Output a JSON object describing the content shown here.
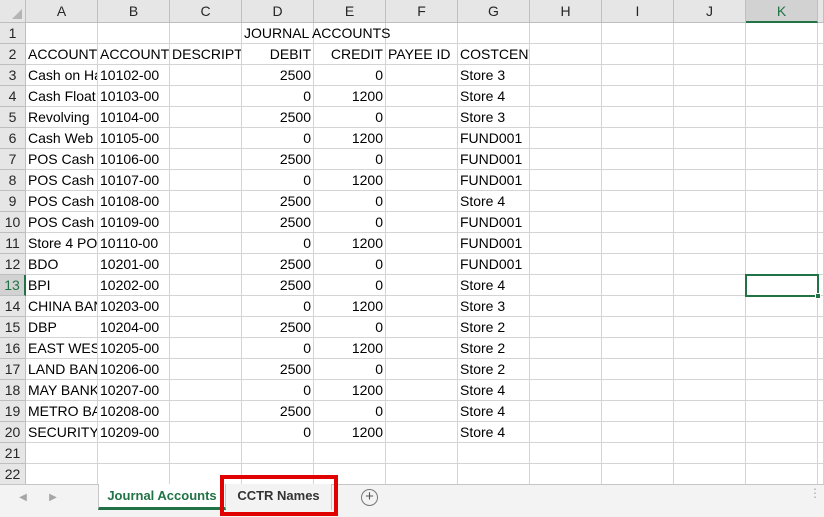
{
  "columns": [
    "A",
    "B",
    "C",
    "D",
    "E",
    "F",
    "G",
    "H",
    "I",
    "J",
    "K"
  ],
  "selected_column": "K",
  "selected_row": 13,
  "rows": [
    {
      "num": 1,
      "cells": {
        "D": "JOURNAL ACCOUNTS"
      }
    },
    {
      "num": 2,
      "cells": {
        "A": "ACCOUNT",
        "B": "ACCOUNT",
        "C": "DESCRIPTIO",
        "D": "DEBIT",
        "E": "CREDIT",
        "F": "PAYEE ID",
        "G": "COSTCENTER"
      }
    },
    {
      "num": 3,
      "cells": {
        "A": "Cash on Ha",
        "B": "10102-00",
        "D": "2500",
        "E": "0",
        "G": "Store 3"
      }
    },
    {
      "num": 4,
      "cells": {
        "A": "Cash Float",
        "B": "10103-00",
        "D": "0",
        "E": "1200",
        "G": "Store 4"
      }
    },
    {
      "num": 5,
      "cells": {
        "A": "Revolving",
        "B": "10104-00",
        "D": "2500",
        "E": "0",
        "G": "Store 3"
      }
    },
    {
      "num": 6,
      "cells": {
        "A": "Cash Web",
        "B": "10105-00",
        "D": "0",
        "E": "1200",
        "G": "FUND001"
      }
    },
    {
      "num": 7,
      "cells": {
        "A": "POS Cash -",
        "B": "10106-00",
        "D": "2500",
        "E": "0",
        "G": "FUND001"
      }
    },
    {
      "num": 8,
      "cells": {
        "A": "POS Cash (",
        "B": "10107-00",
        "D": "0",
        "E": "1200",
        "G": "FUND001"
      }
    },
    {
      "num": 9,
      "cells": {
        "A": "POS Cash S",
        "B": "10108-00",
        "D": "2500",
        "E": "0",
        "G": "Store 4"
      }
    },
    {
      "num": 10,
      "cells": {
        "A": "POS Cash c",
        "B": "10109-00",
        "D": "2500",
        "E": "0",
        "G": "FUND001"
      }
    },
    {
      "num": 11,
      "cells": {
        "A": "Store 4 PO",
        "B": "10110-00",
        "D": "0",
        "E": "1200",
        "G": "FUND001"
      }
    },
    {
      "num": 12,
      "cells": {
        "A": "BDO",
        "B": "10201-00",
        "D": "2500",
        "E": "0",
        "G": "FUND001"
      }
    },
    {
      "num": 13,
      "cells": {
        "A": "BPI",
        "B": "10202-00",
        "D": "2500",
        "E": "0",
        "G": "Store 4"
      }
    },
    {
      "num": 14,
      "cells": {
        "A": "CHINA BAN",
        "B": "10203-00",
        "D": "0",
        "E": "1200",
        "G": "Store 3"
      }
    },
    {
      "num": 15,
      "cells": {
        "A": "DBP",
        "B": "10204-00",
        "D": "2500",
        "E": "0",
        "G": "Store 2"
      }
    },
    {
      "num": 16,
      "cells": {
        "A": "EAST WEST",
        "B": "10205-00",
        "D": "0",
        "E": "1200",
        "G": "Store 2"
      }
    },
    {
      "num": 17,
      "cells": {
        "A": "LAND BAN",
        "B": "10206-00",
        "D": "2500",
        "E": "0",
        "G": "Store 2"
      }
    },
    {
      "num": 18,
      "cells": {
        "A": "MAY BANK",
        "B": "10207-00",
        "D": "0",
        "E": "1200",
        "G": "Store 4"
      }
    },
    {
      "num": 19,
      "cells": {
        "A": "METRO BA",
        "B": "10208-00",
        "D": "2500",
        "E": "0",
        "G": "Store 4"
      }
    },
    {
      "num": 20,
      "cells": {
        "A": "SECURITY",
        "B": "10209-00",
        "D": "0",
        "E": "1200",
        "G": "Store 4"
      }
    },
    {
      "num": 21,
      "cells": {}
    },
    {
      "num": 22,
      "cells": {}
    }
  ],
  "tabs": [
    {
      "label": "Journal Accounts",
      "active": true
    },
    {
      "label": "CCTR Names",
      "active": false
    }
  ],
  "add_sheet_symbol": "+",
  "icons": {
    "prev": "chevron-left-icon",
    "next": "chevron-right-icon",
    "add": "plus-circle-icon",
    "more": "vertical-dots-icon"
  },
  "colors": {
    "accent": "#217346",
    "highlight": "#e00000"
  }
}
